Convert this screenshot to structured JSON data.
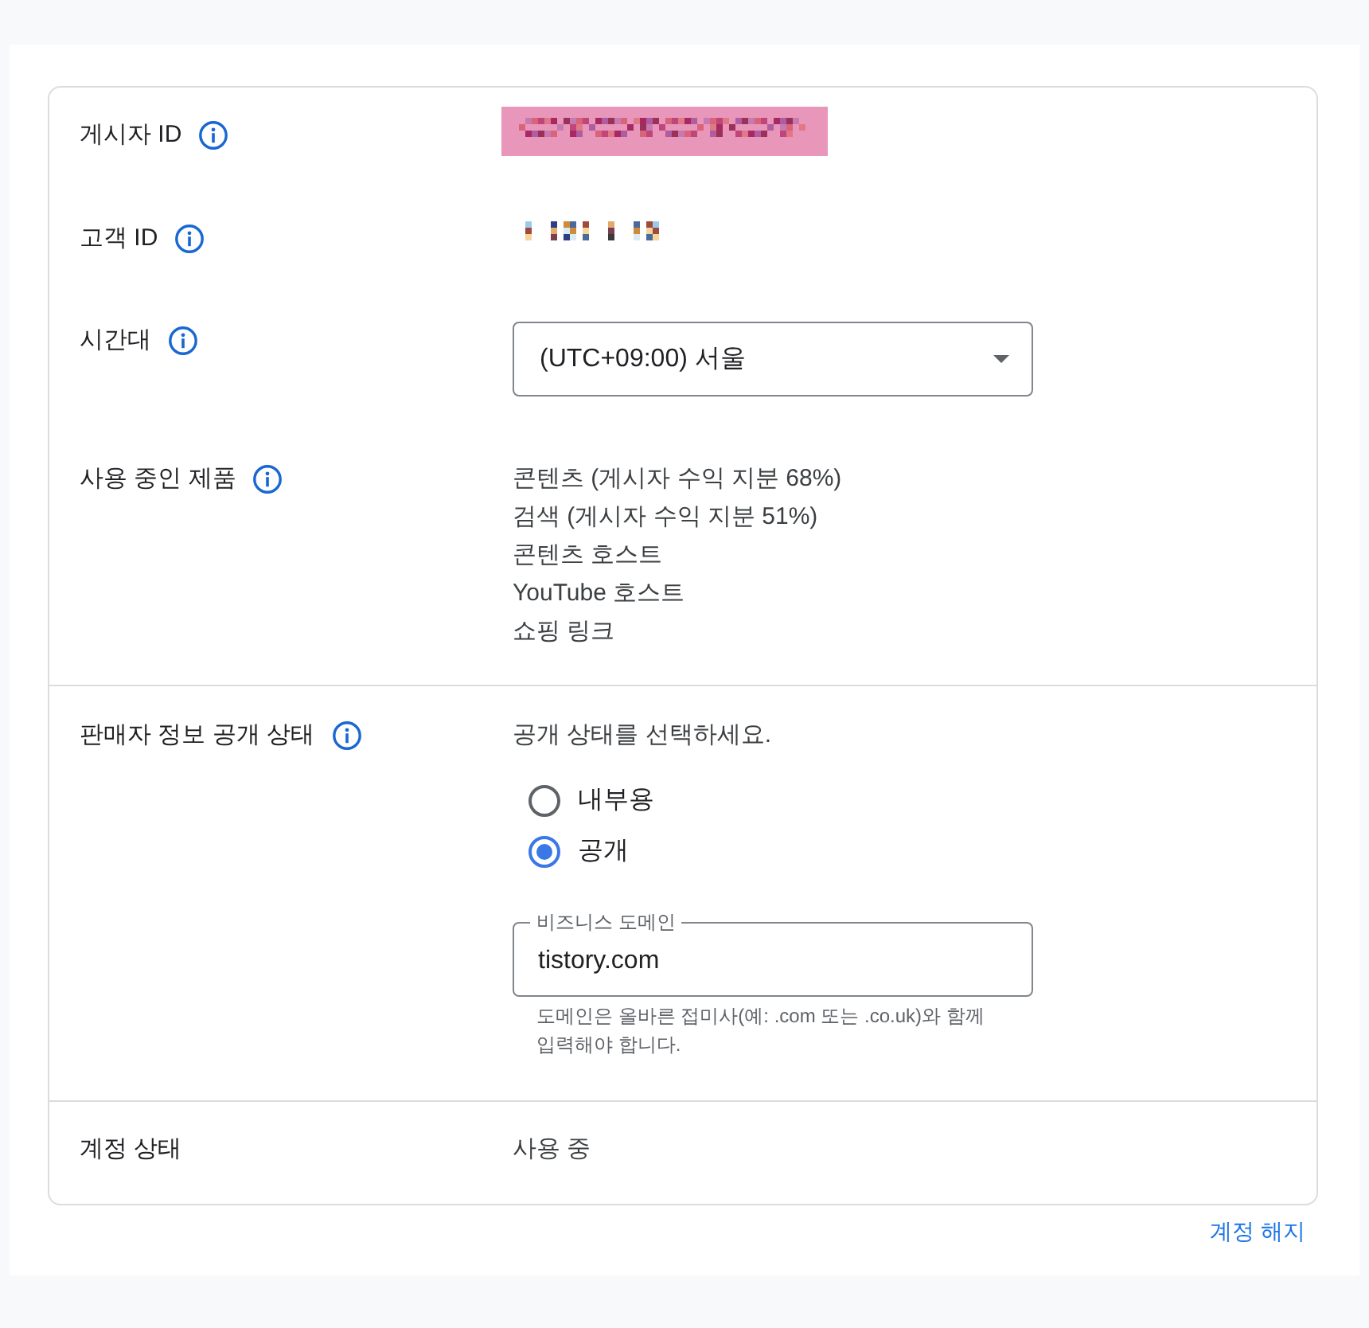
{
  "sections": [
    {
      "rows": [
        {
          "kind": "redacted",
          "label": "게시자 ID",
          "info": true,
          "highlighted": true
        },
        {
          "kind": "redacted",
          "label": "고객 ID",
          "info": true,
          "highlighted": false
        },
        {
          "kind": "dropdown",
          "label": "시간대",
          "info": true,
          "value": "(UTC+09:00) 서울"
        },
        {
          "kind": "list",
          "label": "사용 중인 제품",
          "info": true,
          "items": [
            "콘텐츠 (게시자 수익 지분 68%)",
            "검색 (게시자 수익 지분 51%)",
            "콘텐츠 호스트",
            "YouTube 호스트",
            "쇼핑 링크"
          ]
        }
      ]
    },
    {
      "rows": [
        {
          "kind": "visibility",
          "label": "판매자 정보 공개 상태",
          "info": true,
          "prompt": "공개 상태를 선택하세요.",
          "options": [
            {
              "label": "내부용",
              "selected": false
            },
            {
              "label": "공개",
              "selected": true
            }
          ],
          "field": {
            "label": "비즈니스 도메인",
            "value": "tistory.com",
            "helper": "도메인은 올바른 접미사(예: .com 또는 .co.uk)와 함께 입력해야 합니다."
          }
        }
      ]
    },
    {
      "rows": [
        {
          "kind": "text",
          "label": "계정 상태",
          "info": false,
          "value": "사용 중"
        }
      ]
    }
  ],
  "footer_link": "계정 해지"
}
